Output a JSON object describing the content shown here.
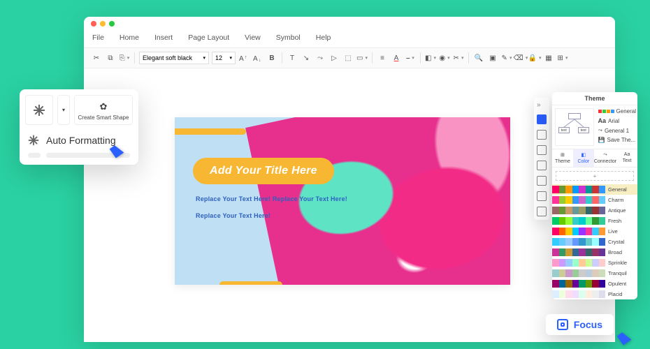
{
  "menus": [
    "File",
    "Home",
    "Insert",
    "Page Layout",
    "View",
    "Symbol",
    "Help"
  ],
  "toolbar": {
    "font": "Elegant soft black",
    "size": "12"
  },
  "slide": {
    "title": "Add Your Title Here",
    "line1": "Replace Your Text Here! Replace Your Text Here!",
    "line2": "Replace Your Text Here!"
  },
  "smartPop": {
    "createShape": "Create Smart Shape",
    "autoFormat": "Auto Formatting"
  },
  "theme": {
    "title": "Theme",
    "opts": {
      "general": "General",
      "font": "Arial",
      "line": "General 1",
      "save": "Save The..."
    },
    "tabs": [
      "Theme",
      "Color",
      "Connector",
      "Text"
    ],
    "palettes": [
      {
        "name": "General",
        "c": [
          "#f06",
          "#693",
          "#f90",
          "#09f",
          "#c3c",
          "#099",
          "#c33",
          "#39f"
        ],
        "sel": true
      },
      {
        "name": "Charm",
        "c": [
          "#f39",
          "#9c3",
          "#fc0",
          "#39f",
          "#c6c",
          "#3cc",
          "#f66",
          "#6cf"
        ]
      },
      {
        "name": "Antique",
        "c": [
          "#966",
          "#693",
          "#c96",
          "#699",
          "#996",
          "#366",
          "#933",
          "#669"
        ]
      },
      {
        "name": "Fresh",
        "c": [
          "#0c6",
          "#6c0",
          "#9f3",
          "#3cc",
          "#0cc",
          "#6f9",
          "#393",
          "#3c9"
        ]
      },
      {
        "name": "Live",
        "c": [
          "#f06",
          "#f60",
          "#fc0",
          "#0cf",
          "#93f",
          "#f39",
          "#3cf",
          "#f93"
        ]
      },
      {
        "name": "Crystal",
        "c": [
          "#3cf",
          "#6cf",
          "#9cf",
          "#69f",
          "#39c",
          "#6cc",
          "#9ff",
          "#36c"
        ]
      },
      {
        "name": "Broad",
        "c": [
          "#c39",
          "#396",
          "#c93",
          "#369",
          "#939",
          "#366",
          "#936",
          "#639"
        ]
      },
      {
        "name": "Sprinkle",
        "c": [
          "#f9c",
          "#c9f",
          "#9cf",
          "#9fc",
          "#fc9",
          "#cf9",
          "#ccf",
          "#fcc"
        ]
      },
      {
        "name": "Tranquil",
        "c": [
          "#9cc",
          "#cc9",
          "#c9c",
          "#9c9",
          "#ccc",
          "#bcd",
          "#dcb",
          "#cdb"
        ]
      },
      {
        "name": "Opulent",
        "c": [
          "#906",
          "#069",
          "#960",
          "#609",
          "#096",
          "#690",
          "#903",
          "#309"
        ]
      },
      {
        "name": "Placid",
        "c": [
          "#def",
          "#efd",
          "#fde",
          "#edf",
          "#dfe",
          "#fed",
          "#eee",
          "#dde"
        ]
      }
    ]
  },
  "focus": "Focus"
}
